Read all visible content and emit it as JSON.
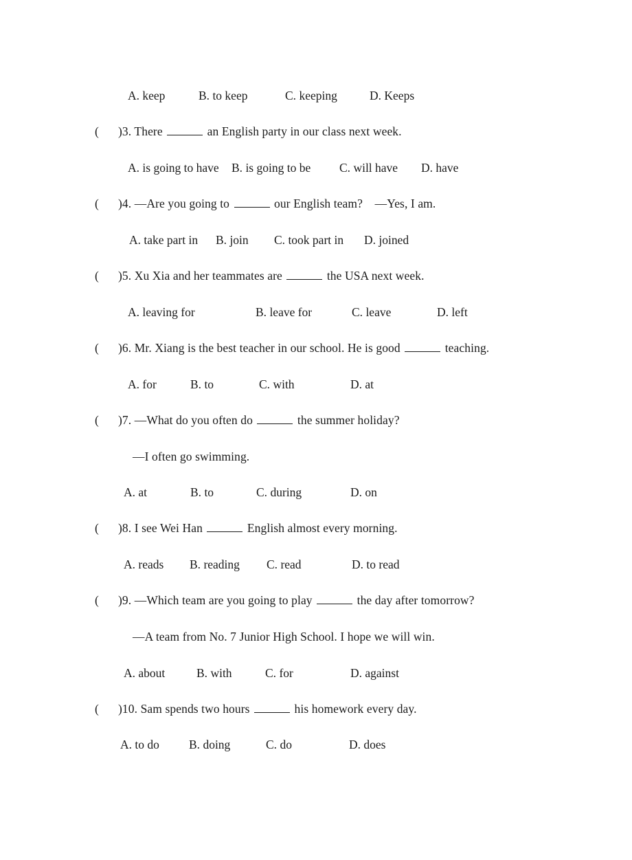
{
  "document": {
    "type": "english-grammar-worksheet",
    "page_background": "#ffffff",
    "text_color": "#1a1a1a"
  },
  "questions": [
    {
      "number": "",
      "marker": "",
      "stem_before": "",
      "stem_after": "",
      "options_label": "q2-options",
      "options": [
        {
          "letter": "A.",
          "text": "keep"
        },
        {
          "letter": "B.",
          "text": "to keep"
        },
        {
          "letter": "C.",
          "text": "keeping"
        },
        {
          "letter": "D.",
          "text": "Keeps"
        }
      ]
    },
    {
      "number": "3",
      "marker": "(",
      "marker_close": ")3.",
      "stem_before": " There ",
      "stem_after": " an English party in our class next week.",
      "options": [
        {
          "letter": "A.",
          "text": "is going to have"
        },
        {
          "letter": "B.",
          "text": "is going to be"
        },
        {
          "letter": "C.",
          "text": "will have"
        },
        {
          "letter": "D.",
          "text": "have"
        }
      ]
    },
    {
      "number": "4",
      "marker": "(",
      "marker_close": ")4.",
      "stem_before": " —Are you going to ",
      "stem_after": " our English team? —Yes, I am.",
      "options": [
        {
          "letter": "A.",
          "text": "take part in"
        },
        {
          "letter": "B.",
          "text": "join"
        },
        {
          "letter": "C.",
          "text": "took part in"
        },
        {
          "letter": "D.",
          "text": "joined"
        }
      ]
    },
    {
      "number": "5",
      "marker": "(",
      "marker_close": ")5.",
      "stem_before": " Xu Xia and her teammates are ",
      "stem_after": " the USA next week.",
      "options": [
        {
          "letter": "A.",
          "text": "leaving for"
        },
        {
          "letter": "B.",
          "text": "leave for"
        },
        {
          "letter": "C.",
          "text": "leave"
        },
        {
          "letter": "D.",
          "text": "left"
        }
      ]
    },
    {
      "number": "6",
      "marker": "(",
      "marker_close": ")6.",
      "stem_before": " Mr. Xiang is the best teacher in our school. He is good ",
      "stem_after": " teaching.",
      "options": [
        {
          "letter": "A.",
          "text": "for"
        },
        {
          "letter": "B.",
          "text": "to"
        },
        {
          "letter": "C.",
          "text": "with"
        },
        {
          "letter": "D.",
          "text": "at"
        }
      ]
    },
    {
      "number": "7",
      "marker": "(",
      "marker_close": ")7.",
      "stem_before": " —What do you often do ",
      "stem_after": " the summer holiday?",
      "reply": "—I often go swimming.",
      "options": [
        {
          "letter": "A.",
          "text": "at"
        },
        {
          "letter": "B.",
          "text": "to"
        },
        {
          "letter": "C.",
          "text": "during"
        },
        {
          "letter": "D.",
          "text": "on"
        }
      ]
    },
    {
      "number": "8",
      "marker": "(",
      "marker_close": ")8.",
      "stem_before": " I see Wei Han ",
      "stem_after": " English almost every morning.",
      "options": [
        {
          "letter": "A.",
          "text": "reads"
        },
        {
          "letter": "B.",
          "text": "reading"
        },
        {
          "letter": "C.",
          "text": "read"
        },
        {
          "letter": "D.",
          "text": "to read"
        }
      ]
    },
    {
      "number": "9",
      "marker": "(",
      "marker_close": ")9.",
      "stem_before": " —Which team are you going to play ",
      "stem_after": " the day after tomorrow?",
      "reply": "—A team from No. 7 Junior High School. I hope we will win.",
      "options": [
        {
          "letter": "A.",
          "text": "about"
        },
        {
          "letter": "B.",
          "text": "with"
        },
        {
          "letter": "C.",
          "text": "for"
        },
        {
          "letter": "D.",
          "text": "against"
        }
      ]
    },
    {
      "number": "10",
      "marker": "(",
      "marker_close": ")10.",
      "stem_before": " Sam spends two hours ",
      "stem_after": " his homework every day.",
      "options": [
        {
          "letter": "A.",
          "text": "to do"
        },
        {
          "letter": "B.",
          "text": "doing"
        },
        {
          "letter": "C.",
          "text": "do"
        },
        {
          "letter": "D.",
          "text": "does"
        }
      ]
    }
  ]
}
